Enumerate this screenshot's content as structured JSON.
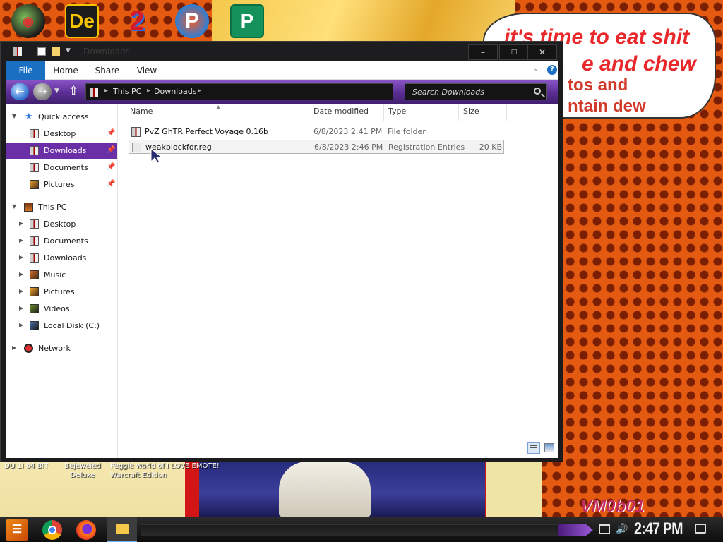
{
  "desktop": {
    "top_icons": [
      {
        "name": "app-icon-1",
        "glyph": "◉"
      },
      {
        "name": "app-icon-2",
        "glyph": "De"
      },
      {
        "name": "app-icon-3",
        "glyph": "2"
      },
      {
        "name": "app-icon-4",
        "glyph": "P"
      },
      {
        "name": "app-icon-5",
        "glyph": "P"
      }
    ],
    "bubble_line1": "it's time to eat shit",
    "bubble_line2": "e and chew",
    "bubble_line3": "tos and",
    "bubble_line4": "ntain dew",
    "bottom_labels": [
      "DU 1I 64 BIT",
      "Bejeweled Deluxe",
      "Peggle world of I LOVE EMOTE! Warcraft Edition"
    ],
    "watermark": "VM0b01"
  },
  "window": {
    "title": "Downloads",
    "controls": {
      "minimize": "–",
      "maximize": "□",
      "close": "✕"
    },
    "ribbon": {
      "file": "File",
      "home": "Home",
      "share": "Share",
      "view": "View",
      "help": "?"
    },
    "address": {
      "crumbs": [
        "This PC",
        "Downloads"
      ],
      "search_placeholder": "Search Downloads"
    },
    "nav": {
      "quick_access": "Quick access",
      "quick_items": [
        "Desktop",
        "Downloads",
        "Documents",
        "Pictures"
      ],
      "this_pc": "This PC",
      "pc_items": [
        "Desktop",
        "Documents",
        "Downloads",
        "Music",
        "Pictures",
        "Videos",
        "Local Disk (C:)"
      ],
      "network": "Network",
      "selected": "Downloads"
    },
    "columns": {
      "name": "Name",
      "date": "Date modified",
      "type": "Type",
      "size": "Size"
    },
    "files": [
      {
        "name": "PvZ GhTR Perfect Voyage 0.16b",
        "date": "6/8/2023 2:41 PM",
        "type": "File folder",
        "size": ""
      },
      {
        "name": "weakblockfor.reg",
        "date": "6/8/2023 2:46 PM",
        "type": "Registration Entries",
        "size": "20 KB"
      }
    ]
  },
  "taskbar": {
    "clock": "2:47 PM",
    "apps": [
      "Chrome",
      "Firefox",
      "File Explorer"
    ]
  }
}
